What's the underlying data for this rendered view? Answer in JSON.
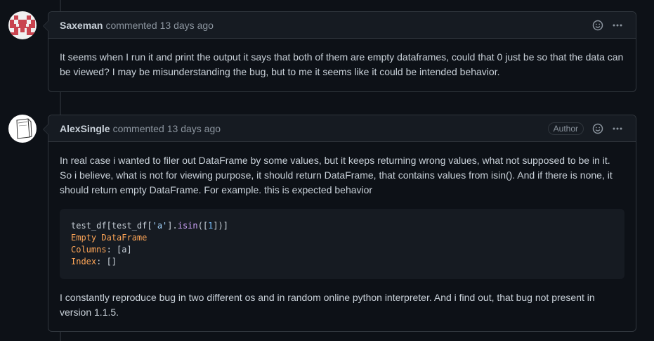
{
  "comments": [
    {
      "author": "Saxeman",
      "verb": "commented",
      "time": "13 days ago",
      "body": "It seems when I run it and print the output it says that both of them are empty dataframes, could that 0 just be so that the data can be viewed? I may be misunderstanding the bug, but to me it seems like it could be intended behavior."
    },
    {
      "author": "AlexSingle",
      "verb": "commented",
      "time": "13 days ago",
      "badge": "Author",
      "body_intro": "In real case i wanted to filer out DataFrame by some values, but it keeps returning wrong values, what not supposed to be in it. So i believe, what is not for viewing purpose, it should return DataFrame, that contains values from isin(). And if there is none, it should return empty DataFrame. For example. this is expected behavior",
      "code": {
        "line1_a": "test_df[test_df[",
        "line1_b": "'a'",
        "line1_c": "].",
        "line1_d": "isin",
        "line1_e": "([",
        "line1_f": "1",
        "line1_g": "])]",
        "line2": "Empty DataFrame",
        "line3_key": "Columns",
        "line3_val": ": [a]",
        "line4_key": "Index",
        "line4_val": ": []"
      },
      "body_outro": "I constantly reproduce bug in two different os and in random online python interpreter. And i find out, that bug not present in version 1.1.5."
    }
  ],
  "icons": {
    "reaction": "smiley-icon",
    "menu": "kebab-horizontal-icon"
  },
  "colors": {
    "background": "#0d1117",
    "header": "#161b22",
    "border": "#30363d",
    "text": "#c9d1d9",
    "muted": "#8b949e"
  }
}
